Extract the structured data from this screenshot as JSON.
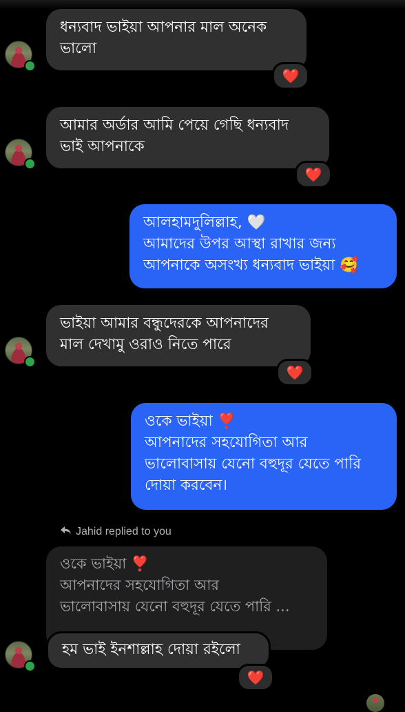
{
  "colors": {
    "background": "#000000",
    "incoming_bubble": "#303030",
    "outgoing_bubble": "#2a64f6",
    "quoted_bubble": "#1f1f1f",
    "online_dot": "#31a24c",
    "reaction_heart": "#f0294a"
  },
  "messages": [
    {
      "direction": "incoming",
      "lines": [
        "ধন্যবাদ ভাইয়া আপনার মাল অনেক",
        "ভালো"
      ],
      "reaction": "❤️"
    },
    {
      "direction": "incoming",
      "lines": [
        "আমার অর্ডার আমি পেয়ে গেছি ধন্যবাদ",
        "ভাই আপনাকে"
      ],
      "reaction": "❤️"
    },
    {
      "direction": "outgoing",
      "lines": [
        "আলহামদুলিল্লাহ, 🤍",
        "আমাদের উপর আস্থা রাখার জন্য",
        "আপনাকে অসংখ্য ধন্যবাদ ভাইয়া 🥰"
      ]
    },
    {
      "direction": "incoming",
      "lines": [
        "ভাইয়া আমার বন্ধুদেরকে আপনাদের",
        "মাল দেখামু ওরাও নিতে পারে"
      ],
      "reaction": "❤️"
    },
    {
      "direction": "outgoing",
      "lines": [
        "ওকে ভাইয়া ❣️",
        "আপনাদের সহযোগিতা আর",
        "ভালোবাসায় যেনো বহুদূর যেতে পারি",
        "দোয়া করবেন।"
      ]
    },
    {
      "direction": "incoming",
      "reply_label": "Jahid replied to you",
      "reply_icon": "reply-arrow-icon",
      "quoted_lines": [
        "ওকে ভাইয়া ❣️",
        "আপনাদের সহযোগিতা আর",
        "ভালোবাসায় যেনো বহুদূর যেতে পারি ..."
      ],
      "lines": [
        "হম ভাই ইনশাল্লাহ দোয়া রইলো"
      ],
      "reaction": "❤️"
    }
  ]
}
